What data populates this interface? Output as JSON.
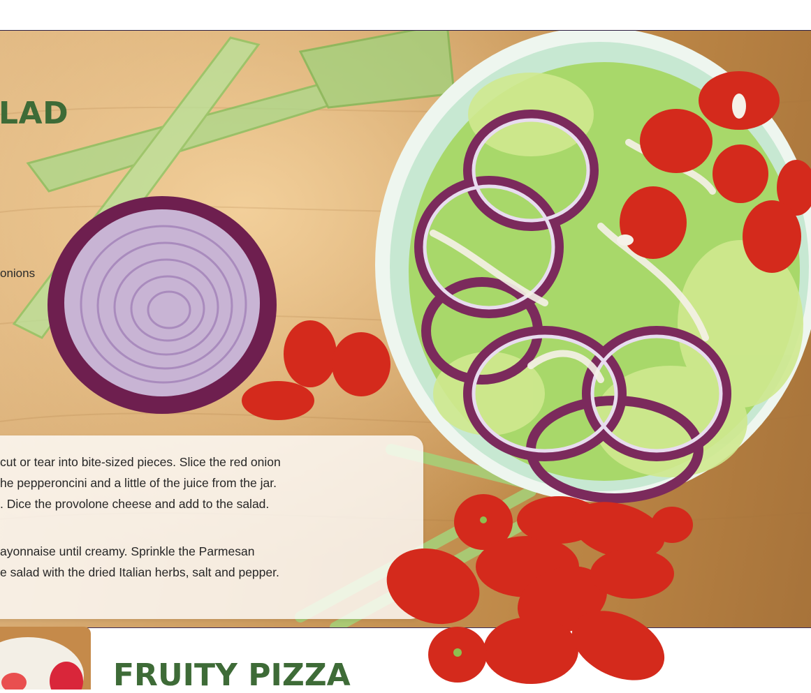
{
  "recipe": {
    "title_partial": "LAD",
    "ingredient_partial": "onions",
    "instructions": {
      "line1": "cut or tear into bite-sized pieces. Slice the red onion",
      "line2": "he pepperoncini and a little of the juice from the jar.",
      "line3": ". Dice the provolone cheese and add to the salad.",
      "line4": "ayonnaise until creamy. Sprinkle the Parmesan",
      "line5": "e salad with the dried Italian herbs, salt and pepper."
    }
  },
  "next_recipe": {
    "title": "FRUITY PIZZA"
  },
  "colors": {
    "title_green": "#3e6b37",
    "wood": "#c99a5e",
    "bowl_mint": "#d8efe0",
    "onion_purple": "#7b2a5c",
    "tomato_red": "#d42a1c"
  }
}
